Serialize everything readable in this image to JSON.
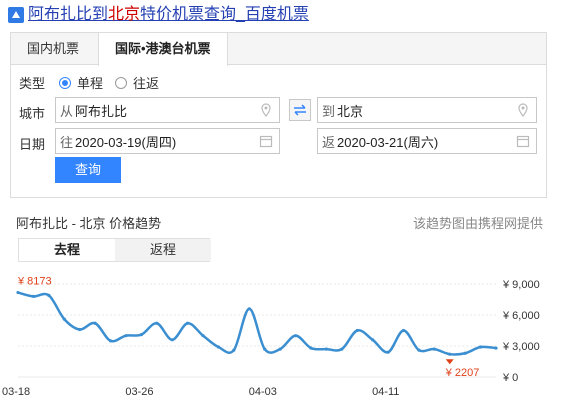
{
  "header": {
    "title_part1": "阿布扎比到",
    "title_highlight": "北京",
    "title_part2": "特价机票查询_百度机票"
  },
  "tabs": [
    {
      "label": "国内机票"
    },
    {
      "label": "国际•港澳台机票"
    }
  ],
  "form": {
    "type_label": "类型",
    "trip_options": [
      {
        "label": "单程",
        "selected": true
      },
      {
        "label": "往返",
        "selected": false
      }
    ],
    "city_label": "城市",
    "from_prefix": "从",
    "from_value": "阿布扎比",
    "to_prefix": "到",
    "to_value": "北京",
    "date_label": "日期",
    "depart_prefix": "往",
    "depart_value": "2020-03-19(周四)",
    "return_prefix": "返",
    "return_value": "2020-03-21(周六)",
    "search_label": "查询"
  },
  "trend": {
    "title": "阿布扎比 - 北京 价格趋势",
    "source": "该趋势图由携程网提供",
    "tabs": [
      {
        "label": "去程"
      },
      {
        "label": "返程"
      }
    ]
  },
  "colors": {
    "link": "#2440b3",
    "highlight": "#cc0000",
    "accent": "#3385ff",
    "line": "#3b8fd1",
    "price_label": "#e0411b"
  },
  "chart_data": {
    "type": "line",
    "xtick_labels": [
      "03-18",
      "03-26",
      "04-03",
      "04-11"
    ],
    "ytick_labels": [
      "¥ 0",
      "¥ 3,000",
      "¥ 6,000",
      "¥ 9,000"
    ],
    "ylim": [
      0,
      9000
    ],
    "x": [
      "03-18",
      "03-19",
      "03-20",
      "03-21",
      "03-22",
      "03-23",
      "03-24",
      "03-25",
      "03-26",
      "03-27",
      "03-28",
      "03-29",
      "03-30",
      "03-31",
      "04-01",
      "04-02",
      "04-03",
      "04-04",
      "04-05",
      "04-06",
      "04-07",
      "04-08",
      "04-09",
      "04-10",
      "04-11",
      "04-12",
      "04-13",
      "04-14",
      "04-15",
      "04-16",
      "04-17",
      "04-18"
    ],
    "series": [
      {
        "values": [
          8173,
          7800,
          7900,
          5600,
          4600,
          5200,
          3500,
          4000,
          4100,
          5200,
          3600,
          5200,
          4000,
          2900,
          2600,
          6600,
          2700,
          2700,
          4000,
          2800,
          2700,
          2700,
          4500,
          3600,
          2400,
          4500,
          2600,
          2700,
          2207,
          2300,
          2900,
          2800
        ]
      }
    ],
    "annotations": [
      {
        "text": "¥ 8173",
        "x": "03-18",
        "y": 8173
      },
      {
        "text": "¥ 2207",
        "x": "04-15",
        "y": 2207
      }
    ],
    "grid": true
  }
}
